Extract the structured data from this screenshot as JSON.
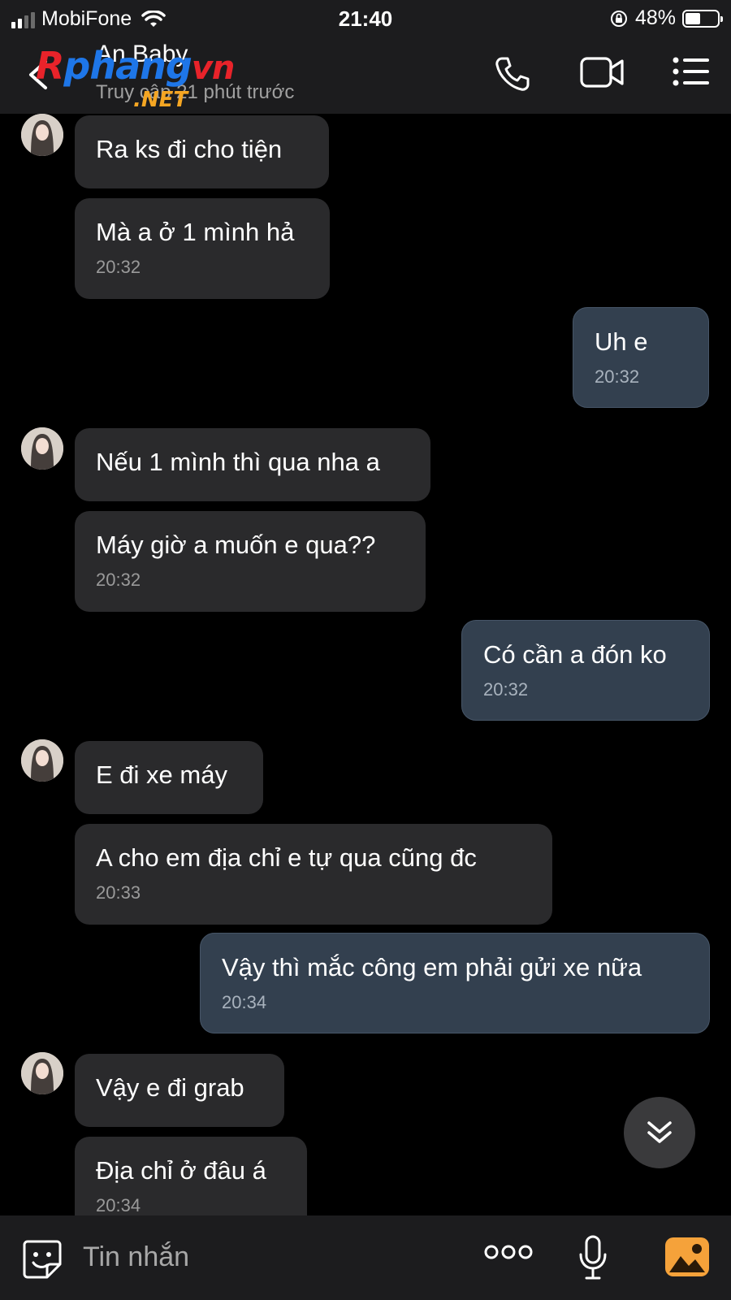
{
  "status_bar": {
    "carrier": "MobiFone",
    "time": "21:40",
    "battery": "48%",
    "battery_level": 0.48
  },
  "header": {
    "contact_name": "An Baby",
    "status": "Truy cập 21 phút trước",
    "watermark_r": "R",
    "watermark_main": "phang",
    "watermark_vn": "vn",
    "watermark_net": ".NET"
  },
  "messages": [
    {
      "side": "in",
      "text": "Ra ks đi cho tiện",
      "time": ""
    },
    {
      "side": "in",
      "text": "Mà a ở 1 mình hả",
      "time": "20:32"
    },
    {
      "side": "out",
      "text": "Uh e",
      "time": "20:32"
    },
    {
      "side": "in",
      "text": "Nếu 1 mình thì qua nha a",
      "time": ""
    },
    {
      "side": "in",
      "text": "Máy giờ a muốn e qua??",
      "time": "20:32"
    },
    {
      "side": "out",
      "text": "Có cần a đón ko",
      "time": "20:32"
    },
    {
      "side": "in",
      "text": "E đi xe máy",
      "time": ""
    },
    {
      "side": "in",
      "text": "A cho em địa chỉ e tự qua cũng đc",
      "time": "20:33"
    },
    {
      "side": "out",
      "text": "Vậy thì mắc công em phải gửi xe nữa",
      "time": "20:34"
    },
    {
      "side": "in",
      "text": "Vậy e đi grab",
      "time": ""
    },
    {
      "side": "in",
      "text": "Địa chỉ ở đâu á",
      "time": "20:34"
    }
  ],
  "input": {
    "placeholder": "Tin nhắn"
  },
  "icons": {
    "back": "chevron-left-icon",
    "call": "phone-icon",
    "video": "video-camera-icon",
    "menu": "list-icon",
    "scroll": "double-chevron-down-icon",
    "sticker": "sticker-face-icon",
    "more": "more-dots-icon",
    "mic": "microphone-icon",
    "image": "image-icon"
  },
  "colors": {
    "incoming_bubble": "#2a2a2c",
    "outgoing_bubble": "#33404f",
    "image_button": "#f5a23a"
  }
}
